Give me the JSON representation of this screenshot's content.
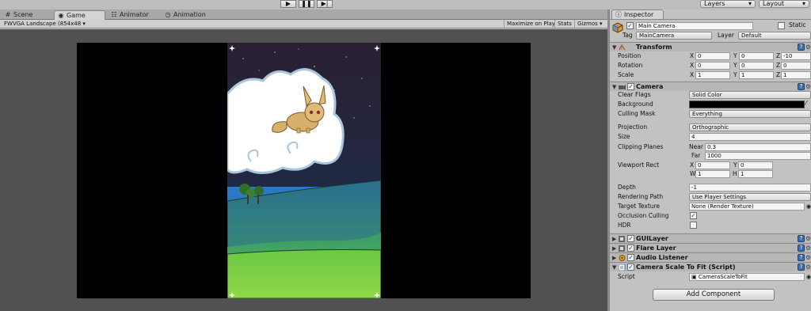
{
  "toolbar": {
    "play_icon": "play-icon",
    "pause_icon": "pause-icon",
    "step_icon": "step-icon",
    "layers_label": "Layers",
    "layout_label": "Layout"
  },
  "tabs": [
    {
      "label": "Scene",
      "icon": "scene-icon",
      "active": false
    },
    {
      "label": "Game",
      "icon": "game-icon",
      "active": true
    },
    {
      "label": "Animator",
      "icon": "animator-icon",
      "active": false
    },
    {
      "label": "Animation",
      "icon": "animation-icon",
      "active": false
    }
  ],
  "game_bar": {
    "aspect": "FWVGA Landscape (854x48",
    "maximize": "Maximize on Play",
    "stats": "Stats",
    "gizmos": "Gizmos"
  },
  "inspector": {
    "tab_label": "Inspector",
    "object_name": "Main Camera",
    "active_checked": true,
    "static_label": "Static",
    "static_checked": false,
    "tag_label": "Tag",
    "tag_value": "MainCamera",
    "layer_label": "Layer",
    "layer_value": "Default",
    "transform": {
      "title": "Transform",
      "position_label": "Position",
      "rotation_label": "Rotation",
      "scale_label": "Scale",
      "position": {
        "x": "0",
        "y": "0",
        "z": "-10"
      },
      "rotation": {
        "x": "0",
        "y": "0",
        "z": "0"
      },
      "scale": {
        "x": "1",
        "y": "1",
        "z": "1"
      }
    },
    "camera": {
      "title": "Camera",
      "clear_flags_label": "Clear Flags",
      "clear_flags": "Solid Color",
      "background_label": "Background",
      "background_color": "#000000",
      "culling_mask_label": "Culling Mask",
      "culling_mask": "Everything",
      "projection_label": "Projection",
      "projection": "Orthographic",
      "size_label": "Size",
      "size": "4",
      "clipping_label": "Clipping Planes",
      "near_label": "Near",
      "near": "0.3",
      "far_label": "Far",
      "far": "1000",
      "viewport_label": "Viewport Rect",
      "viewport": {
        "x": "0",
        "y": "0",
        "w": "1",
        "h": "1"
      },
      "depth_label": "Depth",
      "depth": "-1",
      "rendering_path_label": "Rendering Path",
      "rendering_path": "Use Player Settings",
      "target_texture_label": "Target Texture",
      "target_texture": "None (Render Texture)",
      "occlusion_label": "Occlusion Culling",
      "occlusion_checked": true,
      "hdr_label": "HDR",
      "hdr_checked": false
    },
    "components": [
      {
        "title": "GUILayer",
        "icon": "guilayer-icon"
      },
      {
        "title": "Flare Layer",
        "icon": "flare-layer-icon"
      },
      {
        "title": "Audio Listener",
        "icon": "audio-listener-icon"
      },
      {
        "title": "Camera Scale To Fit (Script)",
        "icon": "script-icon"
      }
    ],
    "script_label": "Script",
    "script_value": "CameraScaleToFit",
    "add_component": "Add Component"
  }
}
